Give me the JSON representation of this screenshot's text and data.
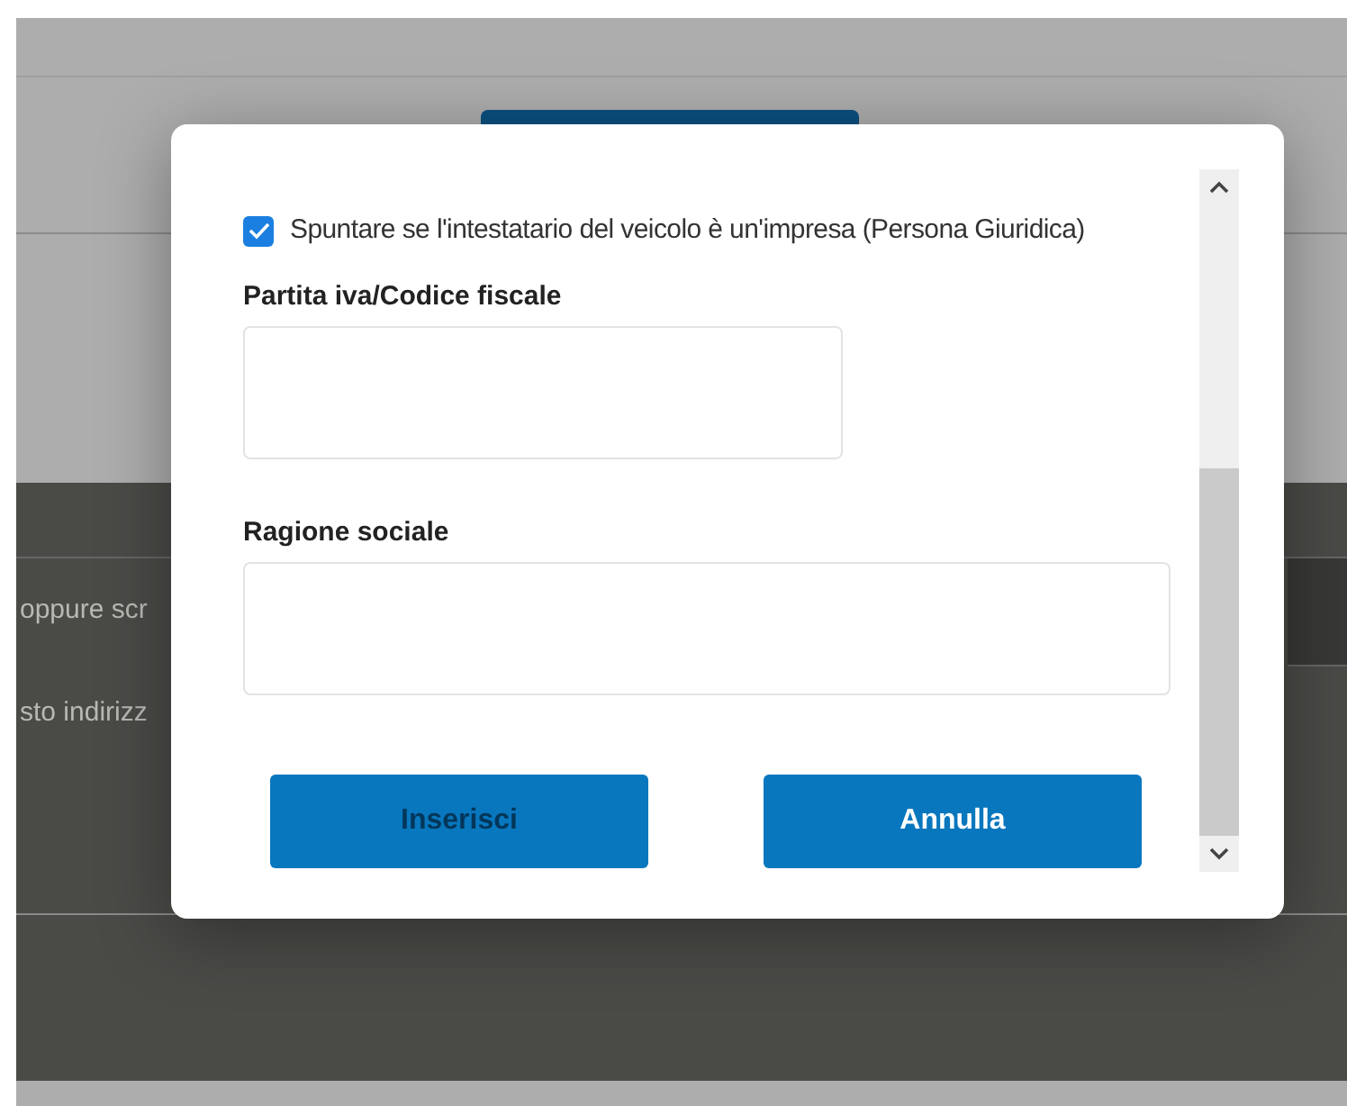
{
  "background": {
    "texts": [
      "oppure scr",
      "sto indirizz"
    ]
  },
  "dialog": {
    "checkbox": {
      "label": "Spuntare se l'intestatario del veicolo è un'impresa (Persona Giuridica)",
      "checked": true
    },
    "fields": [
      {
        "label": "Partita iva/Codice fiscale",
        "kind": "short"
      },
      {
        "label": "Ragione sociale",
        "kind": "wide"
      }
    ],
    "buttons": [
      {
        "label": "Inserisci",
        "disabled": true
      },
      {
        "label": "Annulla",
        "disabled": false
      }
    ]
  }
}
